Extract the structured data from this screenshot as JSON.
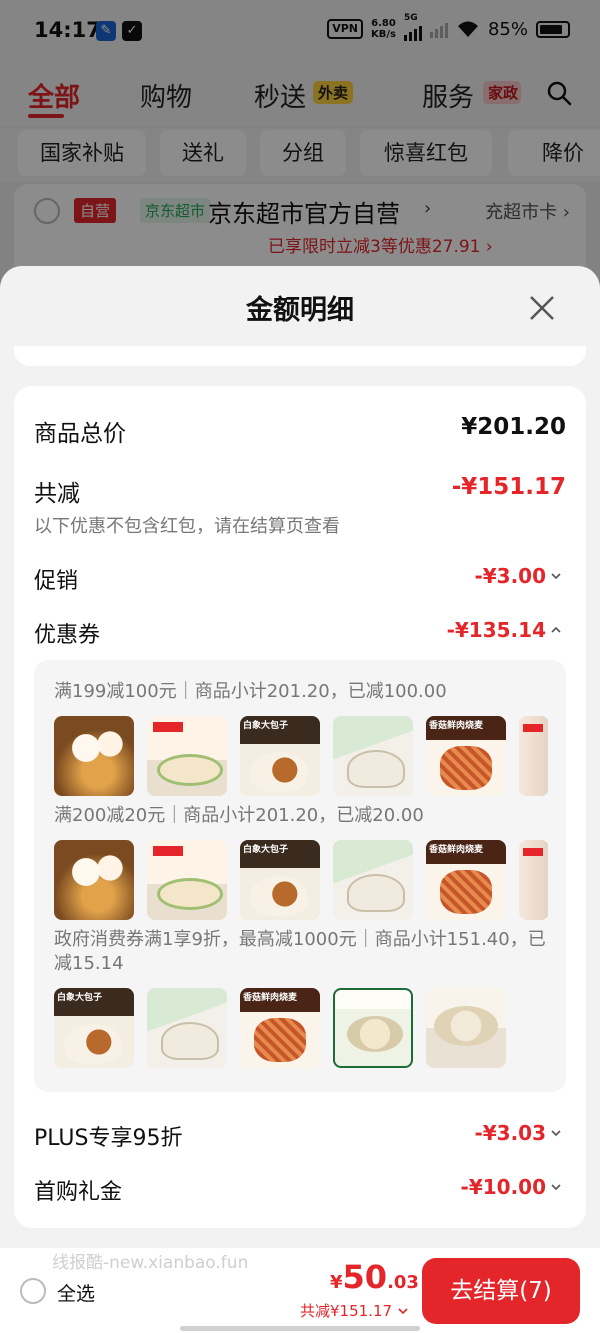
{
  "status_bar": {
    "time": "14:17",
    "vpn": "VPN",
    "net_speed_top": "6.80",
    "net_speed_bottom": "KB/s",
    "network": "5G",
    "battery": "85%"
  },
  "top_tabs": {
    "items": [
      "全部",
      "购物",
      "秒送",
      "服务"
    ],
    "badge_waimai": "外卖",
    "badge_jiazheng": "家政"
  },
  "chips": [
    "国家补贴",
    "送礼",
    "分组",
    "惊喜红包",
    "降价"
  ],
  "store": {
    "tag_ziying": "自营",
    "tag_jd": "京东超市",
    "name": "京东超市官方自营",
    "card": "充超市卡",
    "promo": "已享限时立减3等优惠27.91"
  },
  "sheet": {
    "title": "金额明细",
    "total_label": "商品总价",
    "total_value": "¥201.20",
    "reduce_label": "共减",
    "reduce_value": "-¥151.17",
    "reduce_note": "以下优惠不包含红包，请在结算页查看",
    "promo_label": "促销",
    "promo_value": "-¥3.00",
    "coupon_label": "优惠券",
    "coupon_value": "-¥135.14",
    "coupon_lines": [
      "满199减100元｜商品小计201.20，已减100.00",
      "满200减20元｜商品小计201.20，已减20.00",
      "政府消费券满1享9折，最高减1000元｜商品小计151.40，已减15.14"
    ],
    "product_thumbs": {
      "row1": [
        "ball",
        "cream",
        "baozi",
        "dumpling",
        "shaomai",
        "edge"
      ],
      "row2": [
        "ball",
        "cream",
        "baozi",
        "dumpling",
        "shaomai",
        "edge"
      ],
      "row3": [
        "baozi",
        "dumpling",
        "shaomai",
        "green",
        "plate"
      ]
    },
    "thumb_labels": {
      "baozi": "白象大包子",
      "shaomai": "香菇鲜肉烧麦"
    },
    "plus_label": "PLUS专享95折",
    "plus_value": "-¥3.03",
    "first_label": "首购礼金",
    "first_value": "-¥10.00"
  },
  "bottom_bar": {
    "watermark": "线报酷-new.xianbao.fun",
    "select_all": "全选",
    "price_symbol": "¥",
    "price_int": "50",
    "price_dec": ".03",
    "saved": "共减¥151.17",
    "checkout": "去结算(7)"
  },
  "colors": {
    "accent_red": "#e4262b",
    "jd_green": "#27a45a",
    "waimai_yellow": "#ffd23f"
  }
}
